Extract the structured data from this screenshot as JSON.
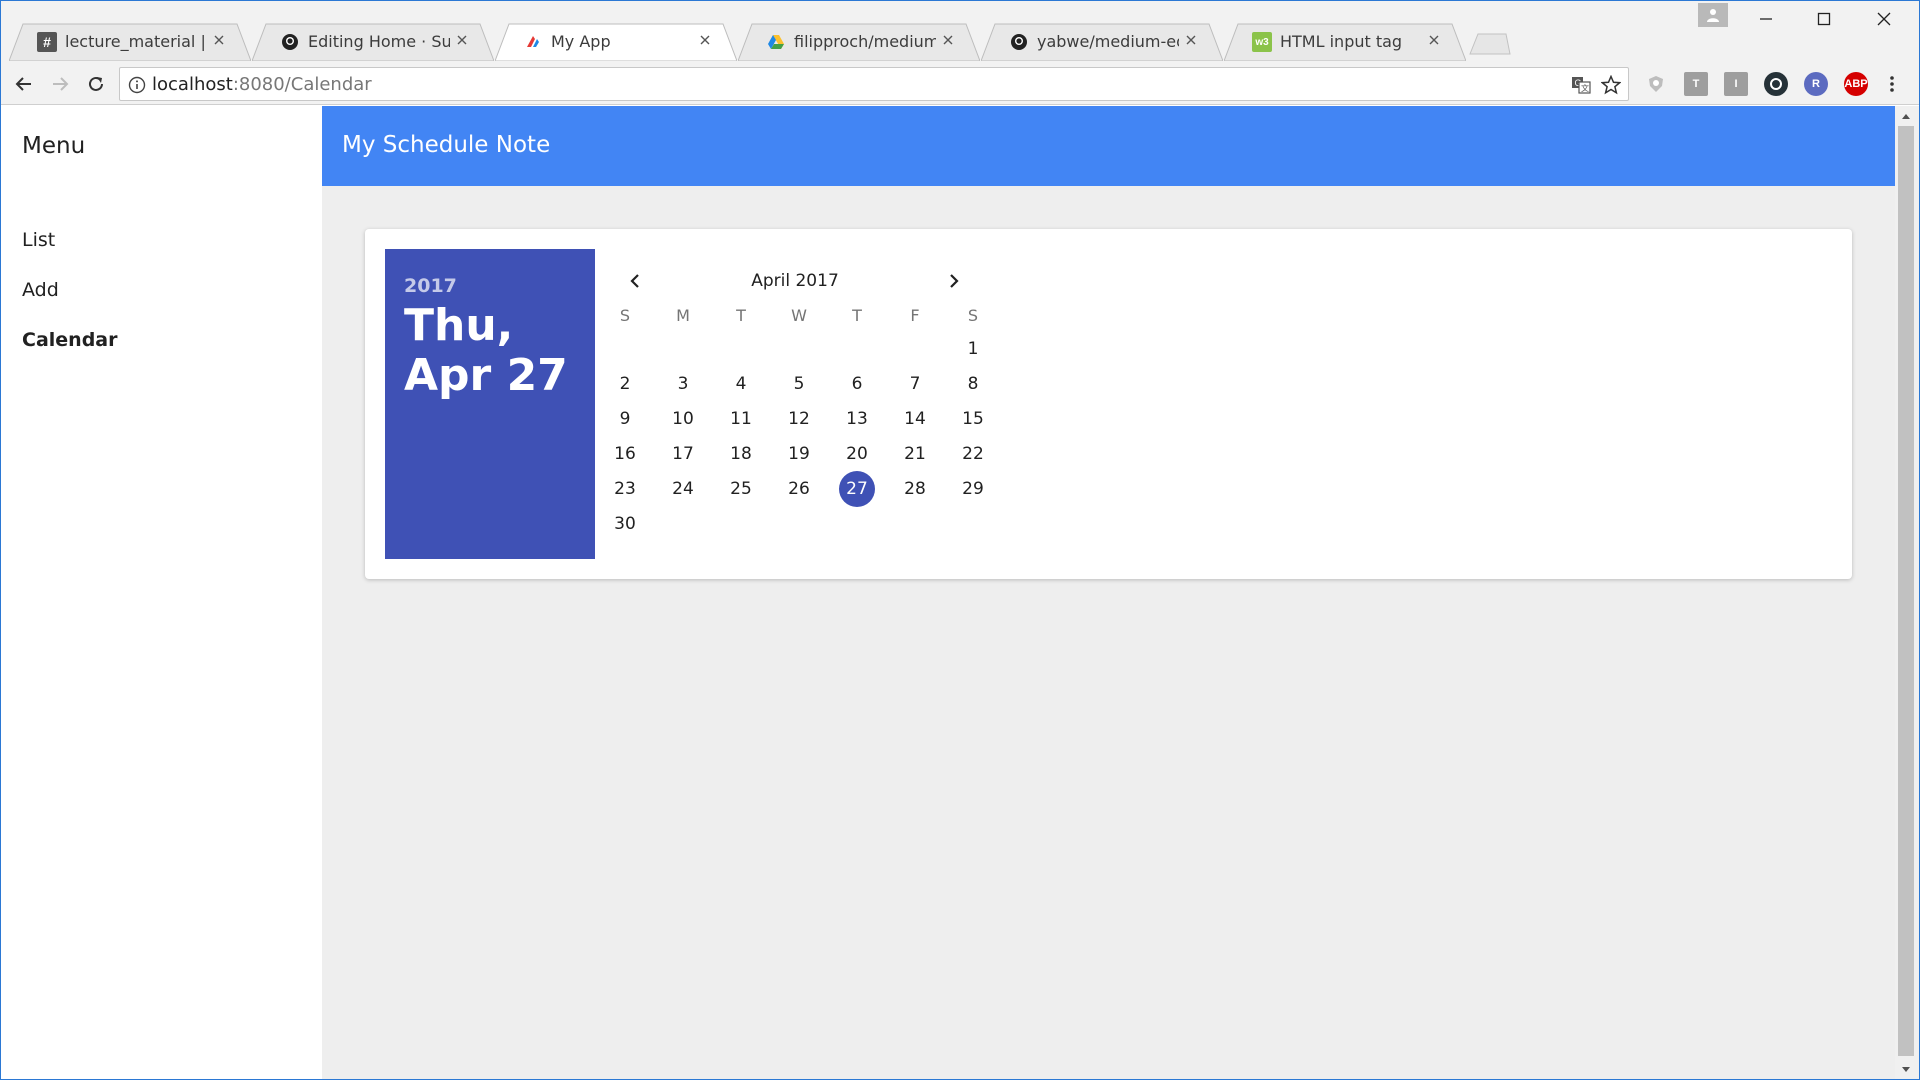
{
  "browser": {
    "tabs": [
      {
        "title": "lecture_material | Hanyang",
        "icon": "hash-icon",
        "icon_color": "#555555",
        "active": false
      },
      {
        "title": "Editing Home · SunSang",
        "icon": "github-icon",
        "icon_color": "#222222",
        "active": false
      },
      {
        "title": "My App",
        "icon": "app-logo-icon",
        "icon_color": "#e53935",
        "active": true
      },
      {
        "title": "filipproch/medium-editor",
        "icon": "drive-icon",
        "icon_color": "#4285f4",
        "active": false
      },
      {
        "title": "yabwe/medium-editor: A",
        "icon": "github-icon",
        "icon_color": "#222222",
        "active": false
      },
      {
        "title": "HTML input tag",
        "icon": "w3schools-icon",
        "icon_color": "#8bc34a",
        "active": false
      }
    ],
    "url_host": "localhost",
    "url_path": ":8080/Calendar",
    "extensions": [
      {
        "name": "extension-shield-icon",
        "label": "",
        "color": "#9e9e9e"
      },
      {
        "name": "extension-t-icon",
        "label": "T",
        "color": "#9e9e9e"
      },
      {
        "name": "extension-i-icon",
        "label": "I",
        "color": "#9e9e9e"
      },
      {
        "name": "extension-face-icon",
        "label": "",
        "color": "#263238"
      },
      {
        "name": "extension-r-icon",
        "label": "R",
        "color": "#5c6bc0"
      },
      {
        "name": "adblock-icon",
        "label": "ABP",
        "color": "#d50000"
      }
    ]
  },
  "drawer": {
    "title": "Menu",
    "items": [
      {
        "label": "List",
        "active": false
      },
      {
        "label": "Add",
        "active": false
      },
      {
        "label": "Calendar",
        "active": true
      }
    ]
  },
  "appbar": {
    "title": "My Schedule Note",
    "color": "#4285f4"
  },
  "datepicker": {
    "accent_color": "#3f51b5",
    "year": "2017",
    "date_full": "Thu, Apr 27",
    "month_label": "April 2017",
    "weekdays": [
      "S",
      "M",
      "T",
      "W",
      "T",
      "F",
      "S"
    ],
    "first_weekday": 6,
    "days_in_month": 30,
    "selected_day": 27
  }
}
